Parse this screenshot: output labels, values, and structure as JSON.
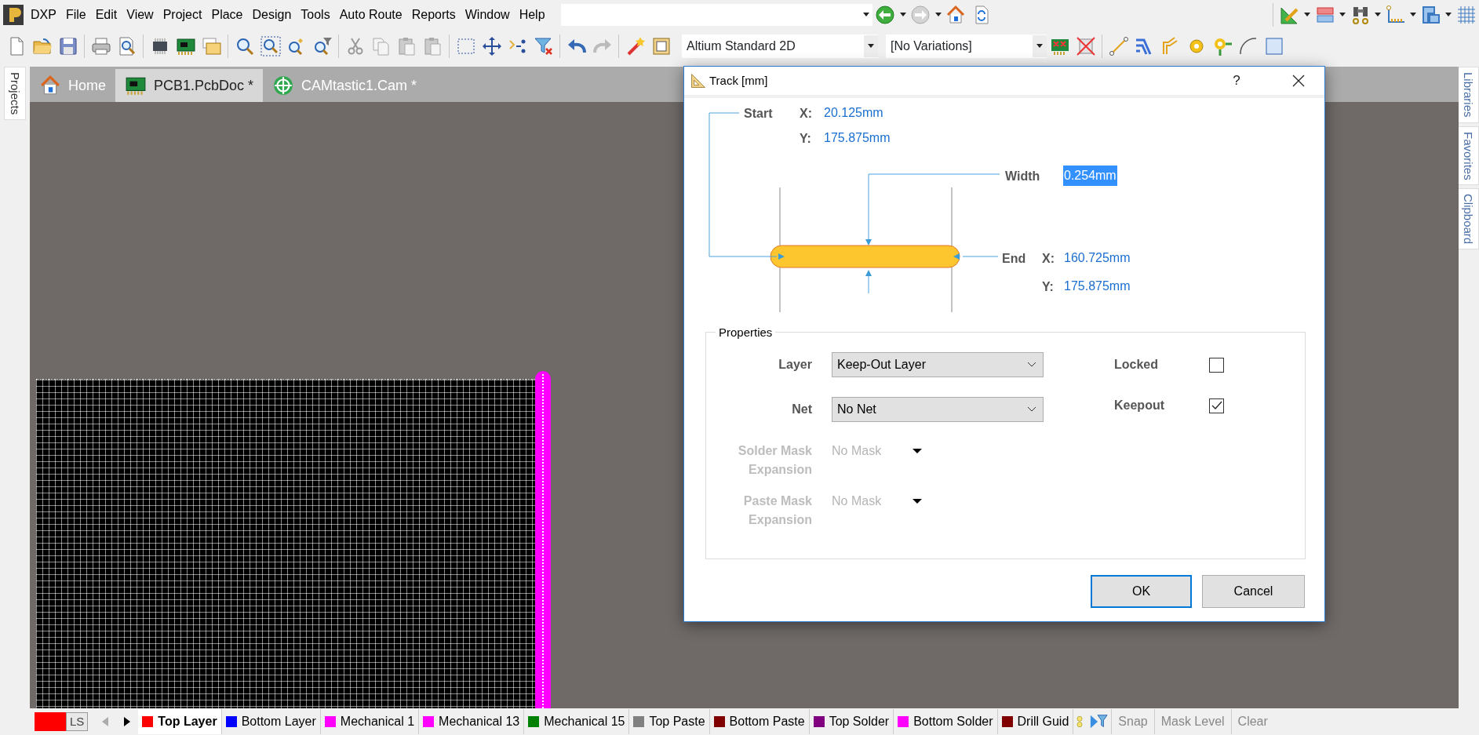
{
  "menu_bar": {
    "items": [
      "DXP",
      "File",
      "Edit",
      "View",
      "Project",
      "Place",
      "Design",
      "Tools",
      "Auto Route",
      "Reports",
      "Window",
      "Help"
    ]
  },
  "toolbar": {
    "view_mode": "Altium Standard 2D",
    "variant": "[No Variations]"
  },
  "left_panel": {
    "tabs": [
      "Projects"
    ]
  },
  "right_panel": {
    "tabs": [
      "Libraries",
      "Favorites",
      "Clipboard"
    ]
  },
  "document_tabs": [
    {
      "label": "Home",
      "kind": "home",
      "selected": false
    },
    {
      "label": "PCB1.PcbDoc *",
      "kind": "pcb",
      "selected": true
    },
    {
      "label": "CAMtastic1.Cam *",
      "kind": "cam",
      "selected": false
    }
  ],
  "dialog": {
    "title": "Track [mm]",
    "help": "?",
    "start": {
      "label": "Start",
      "x_label": "X:",
      "x": "20.125mm",
      "y_label": "Y:",
      "y": "175.875mm"
    },
    "width": {
      "label": "Width",
      "value": "0.254mm",
      "selected": true
    },
    "end": {
      "label": "End",
      "x_label": "X:",
      "x": "160.725mm",
      "y_label": "Y:",
      "y": "175.875mm"
    },
    "properties": {
      "title": "Properties",
      "fields": [
        {
          "label": "Layer",
          "value": "Keep-Out Layer",
          "kind": "select",
          "disabled": false
        },
        {
          "label": "Net",
          "value": "No Net",
          "kind": "select",
          "disabled": false
        },
        {
          "label": "Solder Mask Expansion",
          "value": "No Mask",
          "kind": "mask",
          "disabled": true
        },
        {
          "label": "Paste Mask Expansion",
          "value": "No Mask",
          "kind": "mask",
          "disabled": true
        }
      ],
      "checks": [
        {
          "label": "Locked",
          "checked": false
        },
        {
          "label": "Keepout",
          "checked": true
        }
      ]
    },
    "buttons": [
      {
        "label": "OK",
        "default": true
      },
      {
        "label": "Cancel",
        "default": false
      }
    ]
  },
  "layer_bar": {
    "current_label": "LS",
    "layers": [
      {
        "name": "Top Layer",
        "color": "#ff0000",
        "selected": true
      },
      {
        "name": "Bottom Layer",
        "color": "#0000ff",
        "selected": false
      },
      {
        "name": "Mechanical 1",
        "color": "#ff00ff",
        "selected": false
      },
      {
        "name": "Mechanical 13",
        "color": "#ff00ff",
        "selected": false
      },
      {
        "name": "Mechanical 15",
        "color": "#008000",
        "selected": false
      },
      {
        "name": "Top Paste",
        "color": "#808080",
        "selected": false
      },
      {
        "name": "Bottom Paste",
        "color": "#800000",
        "selected": false
      },
      {
        "name": "Top Solder",
        "color": "#800080",
        "selected": false
      },
      {
        "name": "Bottom Solder",
        "color": "#ff00ff",
        "selected": false
      },
      {
        "name": "Drill Guid",
        "color": "#800000",
        "selected": false
      }
    ],
    "buttons": [
      "Snap",
      "Mask Level",
      "Clear"
    ]
  }
}
